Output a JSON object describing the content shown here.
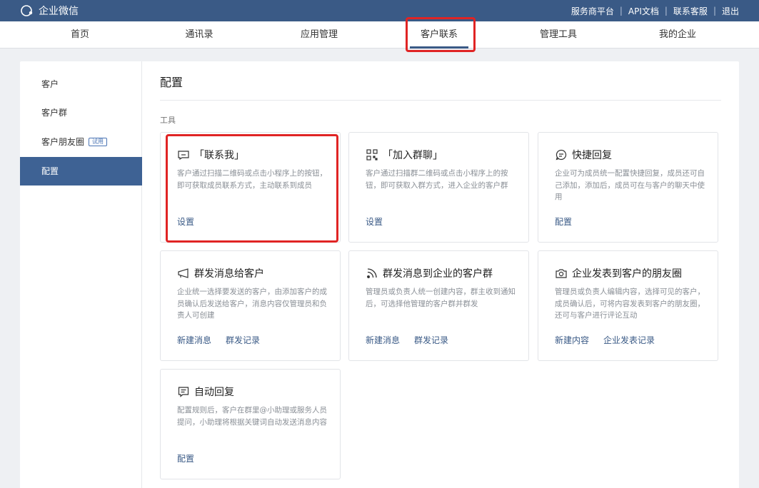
{
  "app": {
    "name": "企业微信",
    "top_links": [
      "服务商平台",
      "API文档",
      "联系客服",
      "退出"
    ]
  },
  "nav": {
    "items": [
      "首页",
      "通讯录",
      "应用管理",
      "客户联系",
      "管理工具",
      "我的企业"
    ],
    "active": "客户联系"
  },
  "sidebar": {
    "items": [
      {
        "label": "客户"
      },
      {
        "label": "客户群"
      },
      {
        "label": "客户朋友圈",
        "badge": "试用"
      },
      {
        "label": "配置"
      }
    ],
    "active": "配置"
  },
  "main": {
    "title": "配置",
    "section_label": "工具",
    "cards": [
      {
        "icon": "contact-me-icon",
        "title": "「联系我」",
        "desc": "客户通过扫描二维码或点击小程序上的按钮，即可获取成员联系方式，主动联系到成员",
        "actions": [
          "设置"
        ]
      },
      {
        "icon": "qrcode-icon",
        "title": "「加入群聊」",
        "desc": "客户通过扫描群二维码或点击小程序上的按钮，即可获取入群方式，进入企业的客户群",
        "actions": [
          "设置"
        ]
      },
      {
        "icon": "quick-reply-icon",
        "title": "快捷回复",
        "desc": "企业可为成员统一配置快捷回复，成员还可自己添加，添加后，成员可在与客户的聊天中使用",
        "actions": [
          "配置"
        ]
      },
      {
        "icon": "broadcast-icon",
        "title": "群发消息给客户",
        "desc": "企业统一选择要发送的客户，由添加客户的成员确认后发送给客户，消息内容仅管理员和负责人可创建",
        "actions": [
          "新建消息",
          "群发记录"
        ]
      },
      {
        "icon": "rss-icon",
        "title": "群发消息到企业的客户群",
        "desc": "管理员或负责人统一创建内容，群主收到通知后，可选择他管理的客户群并群发",
        "actions": [
          "新建消息",
          "群发记录"
        ]
      },
      {
        "icon": "camera-icon",
        "title": "企业发表到客户的朋友圈",
        "desc": "管理员或负责人编辑内容，选择可见的客户，成员确认后，可将内容发表到客户的朋友圈，还可与客户进行评论互动",
        "actions": [
          "新建内容",
          "企业发表记录"
        ]
      },
      {
        "icon": "auto-reply-icon",
        "title": "自动回复",
        "desc": "配置规则后，客户在群里@小助理或服务人员提问，小助理将根据关键词自动发送消息内容",
        "actions": [
          "配置"
        ]
      }
    ]
  }
}
